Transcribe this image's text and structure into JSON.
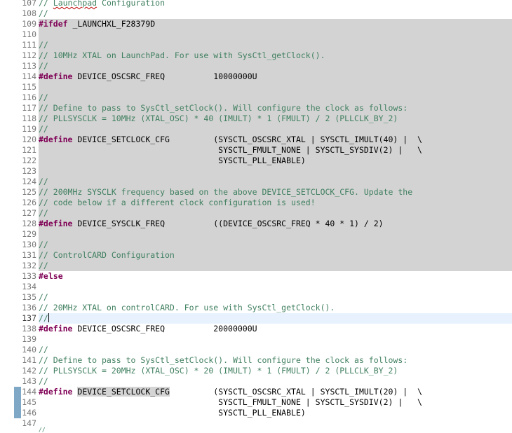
{
  "editor": {
    "lines": [
      {
        "n": "107",
        "bg": "",
        "parts": [
          {
            "t": "// ",
            "c": "comment"
          },
          {
            "t": "Launchpad",
            "c": "comment sq"
          },
          {
            "t": " Configuration",
            "c": "comment"
          }
        ]
      },
      {
        "n": "108",
        "bg": "",
        "parts": [
          {
            "t": "//",
            "c": "comment"
          }
        ]
      },
      {
        "n": "109",
        "bg": "inactive",
        "parts": [
          {
            "t": "#ifdef",
            "c": "kw"
          },
          {
            "t": " _LAUNCHXL_F28379D",
            "c": "plain"
          }
        ]
      },
      {
        "n": "110",
        "bg": "inactive",
        "parts": []
      },
      {
        "n": "111",
        "bg": "inactive",
        "parts": [
          {
            "t": "//",
            "c": "comment"
          }
        ]
      },
      {
        "n": "112",
        "bg": "inactive",
        "parts": [
          {
            "t": "// 10MHz XTAL on LaunchPad. For use with SysCtl_getClock().",
            "c": "comment"
          }
        ]
      },
      {
        "n": "113",
        "bg": "inactive",
        "parts": [
          {
            "t": "//",
            "c": "comment"
          }
        ]
      },
      {
        "n": "114",
        "bg": "inactive",
        "parts": [
          {
            "t": "#define",
            "c": "kw"
          },
          {
            "t": " DEVICE_OSCSRC_FREQ          10000000U",
            "c": "plain"
          }
        ]
      },
      {
        "n": "115",
        "bg": "inactive",
        "parts": []
      },
      {
        "n": "116",
        "bg": "inactive",
        "parts": [
          {
            "t": "//",
            "c": "comment"
          }
        ]
      },
      {
        "n": "117",
        "bg": "inactive",
        "parts": [
          {
            "t": "// Define to pass to SysCtl_setClock(). Will configure the clock as follows:",
            "c": "comment"
          }
        ]
      },
      {
        "n": "118",
        "bg": "inactive",
        "parts": [
          {
            "t": "// PLLSYSCLK = 10MHz (XTAL_OSC) * 40 (IMULT) * 1 (FMULT) / 2 (PLLCLK_BY_2)",
            "c": "comment"
          }
        ]
      },
      {
        "n": "119",
        "bg": "inactive",
        "parts": [
          {
            "t": "//",
            "c": "comment"
          }
        ]
      },
      {
        "n": "120",
        "bg": "inactive",
        "parts": [
          {
            "t": "#define",
            "c": "kw"
          },
          {
            "t": " DEVICE_SETCLOCK_CFG         (SYSCTL_OSCSRC_XTAL | SYSCTL_IMULT(40) |  \\",
            "c": "plain"
          }
        ]
      },
      {
        "n": "121",
        "bg": "inactive",
        "parts": [
          {
            "t": "                                     SYSCTL_FMULT_NONE | SYSCTL_SYSDIV(2) |   \\",
            "c": "plain"
          }
        ]
      },
      {
        "n": "122",
        "bg": "inactive",
        "parts": [
          {
            "t": "                                     SYSCTL_PLL_ENABLE)",
            "c": "plain"
          }
        ]
      },
      {
        "n": "123",
        "bg": "inactive",
        "parts": []
      },
      {
        "n": "124",
        "bg": "inactive",
        "parts": [
          {
            "t": "//",
            "c": "comment"
          }
        ]
      },
      {
        "n": "125",
        "bg": "inactive",
        "parts": [
          {
            "t": "// 200MHz SYSCLK frequency based on the above DEVICE_SETCLOCK_CFG. Update the",
            "c": "comment"
          }
        ]
      },
      {
        "n": "126",
        "bg": "inactive",
        "parts": [
          {
            "t": "// code below if a different clock configuration is used!",
            "c": "comment"
          }
        ]
      },
      {
        "n": "127",
        "bg": "inactive",
        "parts": [
          {
            "t": "//",
            "c": "comment"
          }
        ]
      },
      {
        "n": "128",
        "bg": "inactive",
        "parts": [
          {
            "t": "#define",
            "c": "kw"
          },
          {
            "t": " DEVICE_SYSCLK_FREQ          ((DEVICE_OSCSRC_FREQ * 40 * 1) / 2)",
            "c": "plain"
          }
        ]
      },
      {
        "n": "129",
        "bg": "inactive",
        "parts": []
      },
      {
        "n": "130",
        "bg": "inactive",
        "parts": [
          {
            "t": "//",
            "c": "comment"
          }
        ]
      },
      {
        "n": "131",
        "bg": "inactive",
        "parts": [
          {
            "t": "// ControlCARD Configuration",
            "c": "comment"
          }
        ]
      },
      {
        "n": "132",
        "bg": "inactive",
        "parts": [
          {
            "t": "//",
            "c": "comment"
          }
        ]
      },
      {
        "n": "133",
        "bg": "",
        "parts": [
          {
            "t": "#else",
            "c": "kw"
          }
        ]
      },
      {
        "n": "134",
        "bg": "",
        "parts": []
      },
      {
        "n": "135",
        "bg": "",
        "parts": [
          {
            "t": "//",
            "c": "comment"
          }
        ]
      },
      {
        "n": "136",
        "bg": "",
        "parts": [
          {
            "t": "// 20MHz XTAL on controlCARD. For use with SysCtl_getClock().",
            "c": "comment"
          }
        ]
      },
      {
        "n": "137",
        "bg": "current",
        "parts": [
          {
            "t": "//",
            "c": "comment"
          },
          {
            "t": "",
            "c": "caret"
          }
        ]
      },
      {
        "n": "138",
        "bg": "",
        "parts": [
          {
            "t": "#define",
            "c": "kw"
          },
          {
            "t": " DEVICE_OSCSRC_FREQ          20000000U",
            "c": "plain"
          }
        ]
      },
      {
        "n": "139",
        "bg": "",
        "parts": []
      },
      {
        "n": "140",
        "bg": "",
        "parts": [
          {
            "t": "//",
            "c": "comment"
          }
        ]
      },
      {
        "n": "141",
        "bg": "",
        "parts": [
          {
            "t": "// Define to pass to SysCtl_setClock(). Will configure the clock as follows:",
            "c": "comment"
          }
        ]
      },
      {
        "n": "142",
        "bg": "",
        "parts": [
          {
            "t": "// PLLSYSCLK = 20MHz (XTAL_OSC) * 20 (IMULT) * 1 (FMULT) / 2 (PLLCLK_BY_2)",
            "c": "comment"
          }
        ]
      },
      {
        "n": "143",
        "bg": "",
        "parts": [
          {
            "t": "//",
            "c": "comment"
          }
        ]
      },
      {
        "n": "144",
        "bg": "",
        "marker": true,
        "parts": [
          {
            "t": "#define",
            "c": "kw"
          },
          {
            "t": " ",
            "c": "plain"
          },
          {
            "t": "DEVICE_SETCLOCK_CFG",
            "c": "plain occ"
          },
          {
            "t": "         (SYSCTL_OSCSRC_XTAL | SYSCTL_IMULT(20) |  \\",
            "c": "plain"
          }
        ]
      },
      {
        "n": "145",
        "bg": "",
        "marker": true,
        "parts": [
          {
            "t": "                                     SYSCTL_FMULT_NONE | SYSCTL_SYSDIV(2) |   \\",
            "c": "plain"
          }
        ]
      },
      {
        "n": "146",
        "bg": "",
        "marker": true,
        "parts": [
          {
            "t": "                                     SYSCTL_PLL_ENABLE)",
            "c": "plain"
          }
        ]
      },
      {
        "n": "147",
        "bg": "",
        "parts": []
      }
    ],
    "partial_last": "//"
  }
}
